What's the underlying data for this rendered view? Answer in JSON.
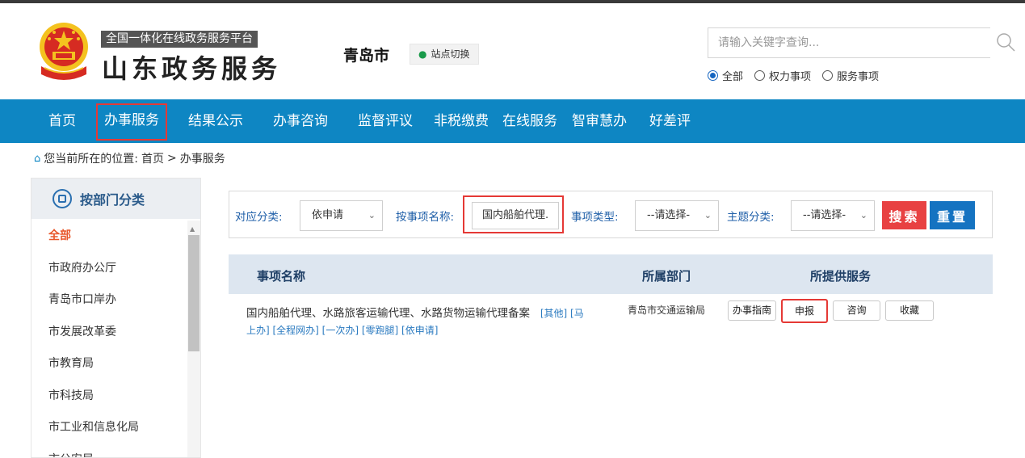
{
  "header": {
    "platform_subtitle": "全国一体化在线政务服务平台",
    "platform_title": "山东政务服务",
    "city": "青岛市",
    "site_switch_label": "站点切换",
    "search_placeholder": "请输入关键字查询...",
    "scope_options": [
      {
        "label": "全部",
        "selected": true
      },
      {
        "label": "权力事项",
        "selected": false
      },
      {
        "label": "服务事项",
        "selected": false
      }
    ]
  },
  "nav": {
    "items": [
      {
        "label": "首页"
      },
      {
        "label": "办事服务",
        "highlighted": true
      },
      {
        "label": "结果公示"
      },
      {
        "label": "办事咨询"
      },
      {
        "label": "监督评议"
      },
      {
        "label": "非税缴费"
      },
      {
        "label": "在线服务"
      },
      {
        "label": "智审慧办"
      },
      {
        "label": "好差评"
      }
    ]
  },
  "breadcrumb": {
    "prefix": "您当前所在的位置:",
    "home": "首页",
    "separator": ">",
    "current": "办事服务"
  },
  "sidebar": {
    "title": "按部门分类",
    "items": [
      {
        "label": "全部",
        "active": true
      },
      {
        "label": "市政府办公厅"
      },
      {
        "label": "青岛市口岸办"
      },
      {
        "label": "市发展改革委"
      },
      {
        "label": "市教育局"
      },
      {
        "label": "市科技局"
      },
      {
        "label": "市工业和信息化局"
      },
      {
        "label": "市公安局"
      }
    ]
  },
  "filter": {
    "category_label": "对应分类:",
    "category_value": "依申请",
    "name_label": "按事项名称:",
    "name_value": "国内船舶代理.",
    "type_label": "事项类型:",
    "type_value": "--请选择-",
    "theme_label": "主题分类:",
    "theme_value": "--请选择-",
    "search_button": "搜索",
    "reset_button": "重置"
  },
  "table": {
    "headers": {
      "name": "事项名称",
      "dept": "所属部门",
      "services": "所提供服务"
    },
    "rows": [
      {
        "name": "国内船舶代理、水路旅客运输代理、水路货物运输代理备案",
        "tags_line1": "[其他] [马",
        "tags_line2": "上办] [全程网办] [一次办] [零跑腿] [依申请]",
        "dept": "青岛市交通运输局",
        "services": [
          "办事指南",
          "申报",
          "咨询",
          "收藏"
        ],
        "highlighted_service": "申报"
      }
    ]
  },
  "colors": {
    "nav_bg": "#0e86c3",
    "highlight": "#e53935",
    "search_btn": "#e84142",
    "reset_btn": "#1573c1",
    "active_side": "#e8572a"
  },
  "icons": [
    "emblem-icon",
    "location-pin-icon",
    "search-icon",
    "home-icon",
    "department-icon",
    "chevron-down-icon"
  ]
}
